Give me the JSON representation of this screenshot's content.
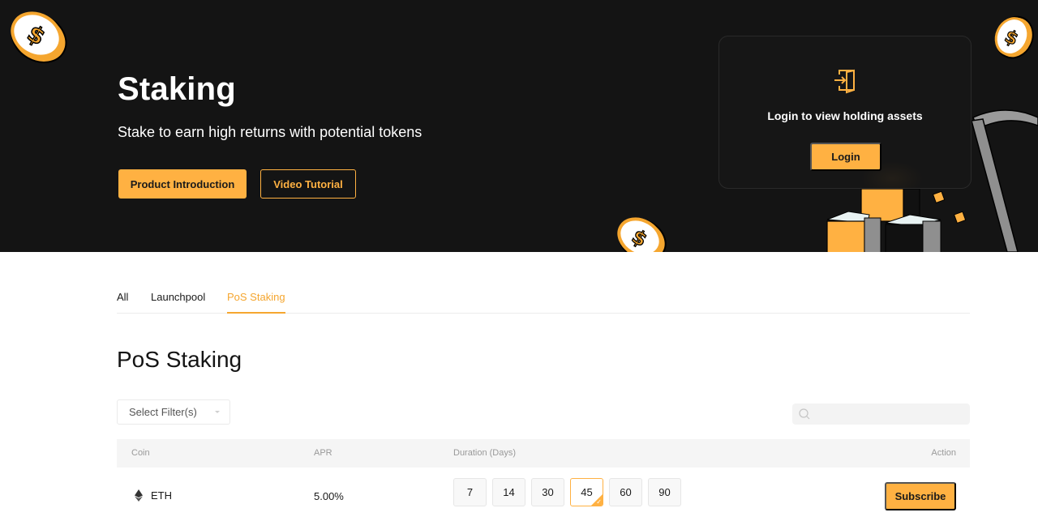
{
  "hero": {
    "title": "Staking",
    "subtitle": "Stake to earn high returns with potential tokens",
    "buttons": {
      "product_intro": "Product Introduction",
      "video_tutorial": "Video Tutorial"
    },
    "login_card": {
      "icon": "login-door-icon",
      "message": "Login to view holding assets",
      "button": "Login"
    },
    "colors": {
      "accent": "#ffb142",
      "background": "#141414"
    }
  },
  "tabs": [
    {
      "label": "All",
      "active": false
    },
    {
      "label": "Launchpool",
      "active": false
    },
    {
      "label": "PoS Staking",
      "active": true
    }
  ],
  "section": {
    "title": "PoS Staking",
    "filter": {
      "placeholder": "Select Filter(s)"
    },
    "search": {
      "placeholder": "",
      "value": "",
      "icon": "search-icon"
    }
  },
  "table": {
    "columns": [
      "Coin",
      "APR",
      "Duration (Days)",
      "Action"
    ],
    "rows": [
      {
        "coin": "ETH",
        "coin_icon": "ethereum-icon",
        "apr": "5.00%",
        "durations": [
          "7",
          "14",
          "30",
          "45",
          "60",
          "90"
        ],
        "selected_duration": "45",
        "action": "Subscribe"
      }
    ]
  }
}
